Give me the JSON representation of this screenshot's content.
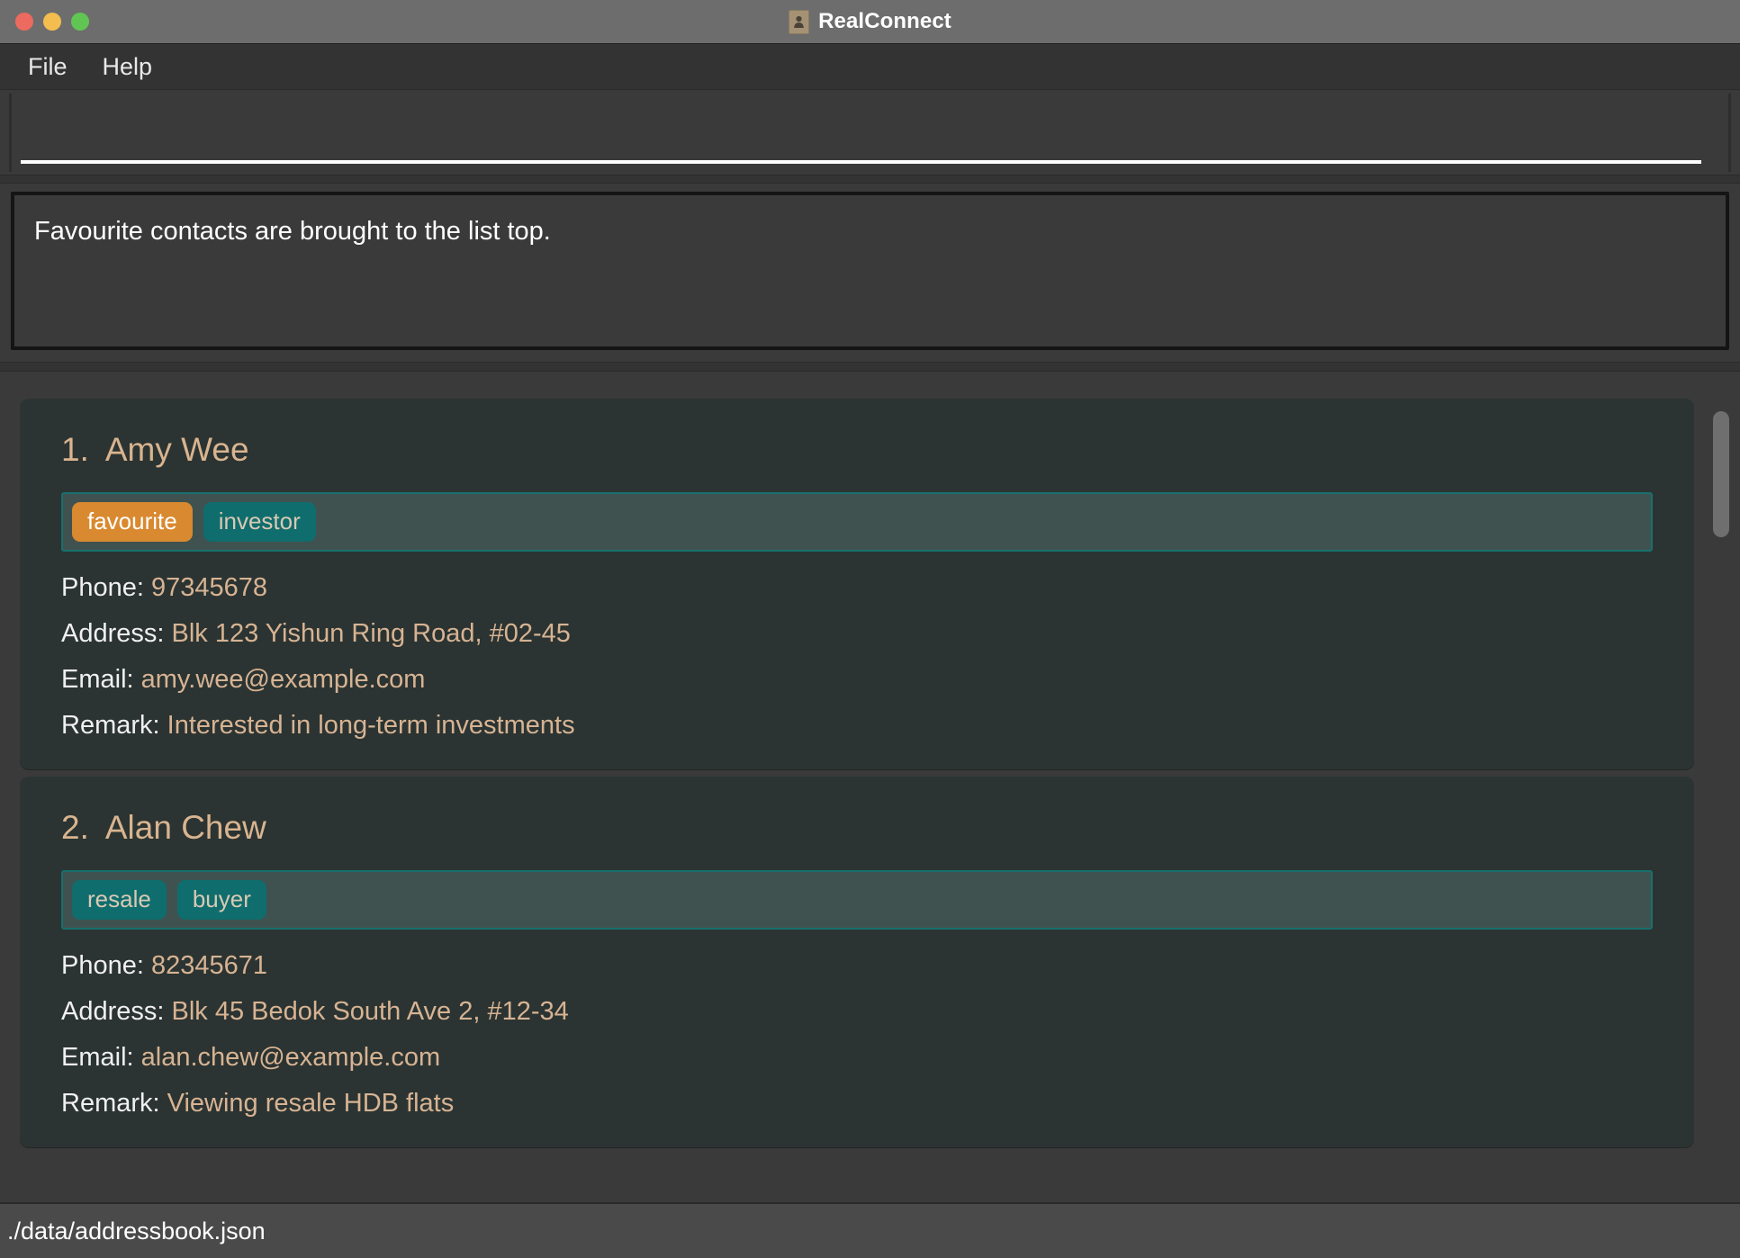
{
  "window": {
    "title": "RealConnect",
    "app_icon": "person-card-icon",
    "traffic_lights": [
      "close",
      "minimize",
      "maximize"
    ]
  },
  "menubar": {
    "items": [
      {
        "label": "File",
        "name": "menu-file"
      },
      {
        "label": "Help",
        "name": "menu-help"
      }
    ]
  },
  "command": {
    "value": "",
    "placeholder": ""
  },
  "result": {
    "message": "Favourite contacts are brought to the list top."
  },
  "contacts": [
    {
      "index": "1.",
      "name": "Amy Wee",
      "tags": [
        {
          "label": "favourite",
          "style": "favourite"
        },
        {
          "label": "investor",
          "style": "default"
        }
      ],
      "phone_label": "Phone:",
      "phone": "97345678",
      "address_label": "Address:",
      "address": "Blk 123 Yishun Ring Road, #02-45",
      "email_label": "Email:",
      "email": "amy.wee@example.com",
      "remark_label": "Remark:",
      "remark": "Interested in long-term investments"
    },
    {
      "index": "2.",
      "name": "Alan Chew",
      "tags": [
        {
          "label": "resale",
          "style": "default"
        },
        {
          "label": "buyer",
          "style": "default"
        }
      ],
      "phone_label": "Phone:",
      "phone": "82345671",
      "address_label": "Address:",
      "address": "Blk 45 Bedok South Ave 2, #12-34",
      "email_label": "Email:",
      "email": "alan.chew@example.com",
      "remark_label": "Remark:",
      "remark": "Viewing resale HDB flats"
    }
  ],
  "statusbar": {
    "save_location": "./data/addressbook.json"
  },
  "colors": {
    "titlebar": "#6d6d6d",
    "chrome": "#3a3a3a",
    "card_bg": "#2b3432",
    "accent_tan": "#d9b48f",
    "value_tan": "#d7b393",
    "tag_teal": "#0f6d6d",
    "tag_orange": "#d9892f",
    "tag_row_bg": "#3f5250",
    "statusbar": "#4a4a4a"
  }
}
